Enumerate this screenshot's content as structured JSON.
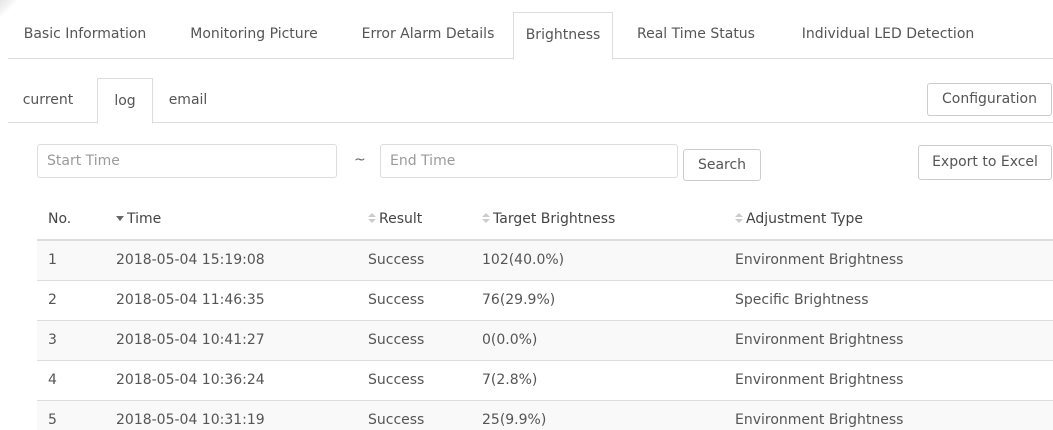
{
  "top_tabs": [
    {
      "label": "Basic Information",
      "active": false
    },
    {
      "label": "Monitoring Picture",
      "active": false
    },
    {
      "label": "Error Alarm Details",
      "active": false
    },
    {
      "label": "Brightness",
      "active": true
    },
    {
      "label": "Real Time Status",
      "active": false
    },
    {
      "label": "Individual LED Detection",
      "active": false
    }
  ],
  "sub_tabs": [
    {
      "label": "current",
      "active": false
    },
    {
      "label": "log",
      "active": true
    },
    {
      "label": "email",
      "active": false
    }
  ],
  "toolbar": {
    "configuration_label": "Configuration",
    "search_label": "Search",
    "export_label": "Export to Excel",
    "range_separator": "~"
  },
  "filters": {
    "start_placeholder": "Start Time",
    "start_value": "",
    "end_placeholder": "End Time",
    "end_value": ""
  },
  "table": {
    "columns": [
      {
        "label": "No.",
        "sort": "none"
      },
      {
        "label": "Time",
        "sort": "desc"
      },
      {
        "label": "Result",
        "sort": "both"
      },
      {
        "label": "Target Brightness",
        "sort": "both"
      },
      {
        "label": "Adjustment Type",
        "sort": "both"
      }
    ],
    "rows": [
      {
        "no": "1",
        "time": "2018-05-04 15:19:08",
        "result": "Success",
        "target": "102(40.0%)",
        "adjustment": "Environment Brightness"
      },
      {
        "no": "2",
        "time": "2018-05-04 11:46:35",
        "result": "Success",
        "target": "76(29.9%)",
        "adjustment": "Specific Brightness"
      },
      {
        "no": "3",
        "time": "2018-05-04 10:41:27",
        "result": "Success",
        "target": "0(0.0%)",
        "adjustment": "Environment Brightness"
      },
      {
        "no": "4",
        "time": "2018-05-04 10:36:24",
        "result": "Success",
        "target": "7(2.8%)",
        "adjustment": "Environment Brightness"
      },
      {
        "no": "5",
        "time": "2018-05-04 10:31:19",
        "result": "Success",
        "target": "25(9.9%)",
        "adjustment": "Environment Brightness"
      }
    ]
  },
  "colors": {
    "border": "#dddddd",
    "text": "#555555",
    "stripe": "#f9f9f9",
    "sort_icon": "#cccccc",
    "sort_icon_active": "#666666"
  }
}
